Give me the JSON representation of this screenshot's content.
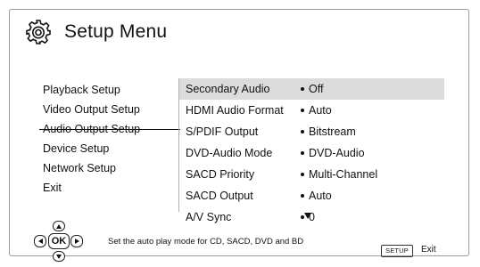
{
  "header": {
    "title": "Setup Menu",
    "icon": "gear-icon"
  },
  "left_menu": {
    "items": [
      {
        "label": "Playback Setup"
      },
      {
        "label": "Video Output Setup"
      },
      {
        "label": "Audio Output Setup",
        "active": true
      },
      {
        "label": "Device Setup"
      },
      {
        "label": "Network Setup"
      },
      {
        "label": "Exit"
      }
    ]
  },
  "options": {
    "rows": [
      {
        "label": "Secondary Audio",
        "value": "Off",
        "selected": true
      },
      {
        "label": "HDMI Audio Format",
        "value": "Auto"
      },
      {
        "label": "S/PDIF Output",
        "value": "Bitstream"
      },
      {
        "label": "DVD-Audio Mode",
        "value": "DVD-Audio"
      },
      {
        "label": "SACD Priority",
        "value": "Multi-Channel"
      },
      {
        "label": "SACD Output",
        "value": "Auto"
      },
      {
        "label": "A/V Sync",
        "value": "0"
      }
    ],
    "more_indicator": "down-arrow-icon"
  },
  "footer": {
    "hint": "Set the auto play mode for CD, SACD, DVD and BD",
    "ok_label": "OK",
    "setup_key_label": "SETUP",
    "exit_label": "Exit"
  },
  "colors": {
    "selected_row_bg": "#dcdcdc",
    "frame_border": "#9a9a9a",
    "text": "#111111"
  }
}
